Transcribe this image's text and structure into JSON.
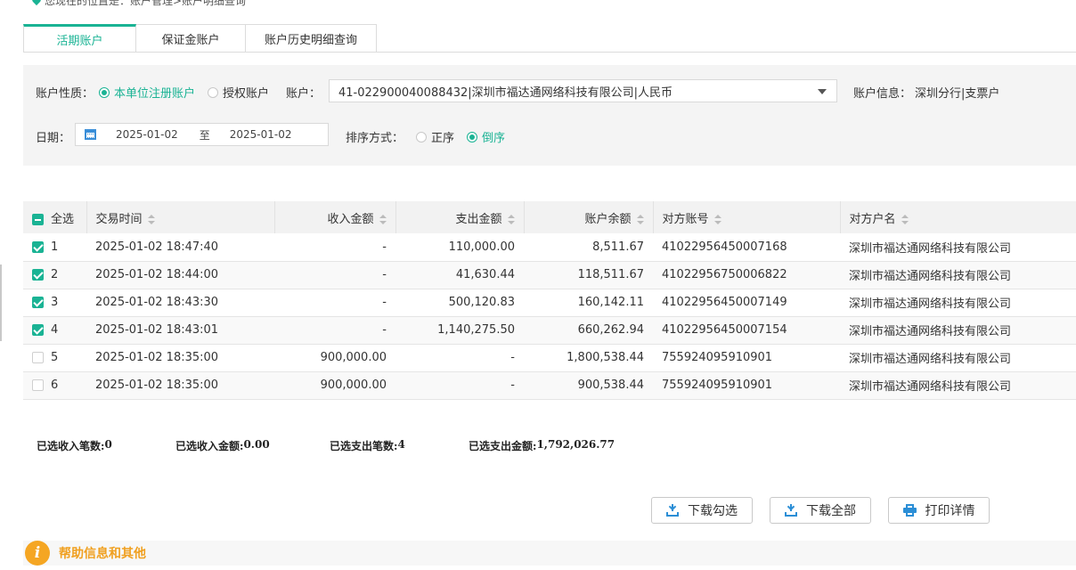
{
  "breadcrumb": "您现在的位置是：账户管理>账户明细查询",
  "tabs": [
    "活期账户",
    "保证金账户",
    "账户历史明细查询"
  ],
  "filters": {
    "account_type_label": "账户性质：",
    "account_type_options": [
      "本单位注册账户",
      "授权账户"
    ],
    "account_type_selected": "本单位注册账户",
    "account_label": "账户：",
    "account_value": "41-022900040088432|深圳市福达通网络科技有限公司|人民币",
    "account_info_label": "账户信息：",
    "account_info_value": "深圳分行|支票户",
    "date_label": "日期：",
    "date_from": "2025-01-02",
    "date_sep": "至",
    "date_to": "2025-01-02",
    "sort_label": "排序方式：",
    "sort_options": [
      "正序",
      "倒序"
    ],
    "sort_selected": "倒序"
  },
  "table": {
    "select_all_label": "全选",
    "columns": [
      "交易时间",
      "收入金额",
      "支出金额",
      "账户余额",
      "对方账号",
      "对方户名"
    ],
    "rows": [
      {
        "no": "1",
        "checked": true,
        "time": "2025-01-02 18:47:40",
        "income": "-",
        "expense": "110,000.00",
        "balance": "8,511.67",
        "account": "41022956450007168",
        "name": "深圳市福达通网络科技有限公司"
      },
      {
        "no": "2",
        "checked": true,
        "time": "2025-01-02 18:44:00",
        "income": "-",
        "expense": "41,630.44",
        "balance": "118,511.67",
        "account": "41022956750006822",
        "name": "深圳市福达通网络科技有限公司"
      },
      {
        "no": "3",
        "checked": true,
        "time": "2025-01-02 18:43:30",
        "income": "-",
        "expense": "500,120.83",
        "balance": "160,142.11",
        "account": "41022956450007149",
        "name": "深圳市福达通网络科技有限公司"
      },
      {
        "no": "4",
        "checked": true,
        "time": "2025-01-02 18:43:01",
        "income": "-",
        "expense": "1,140,275.50",
        "balance": "660,262.94",
        "account": "41022956450007154",
        "name": "深圳市福达通网络科技有限公司"
      },
      {
        "no": "5",
        "checked": false,
        "time": "2025-01-02 18:35:00",
        "income": "900,000.00",
        "expense": "-",
        "balance": "1,800,538.44",
        "account": "755924095910901",
        "name": "深圳市福达通网络科技有限公司"
      },
      {
        "no": "6",
        "checked": false,
        "time": "2025-01-02 18:35:00",
        "income": "900,000.00",
        "expense": "-",
        "balance": "900,538.44",
        "account": "755924095910901",
        "name": "深圳市福达通网络科技有限公司"
      }
    ]
  },
  "summary": [
    {
      "label": "已选收入笔数: ",
      "value": "0"
    },
    {
      "label": "已选收入金额: ",
      "value": "0.00"
    },
    {
      "label": "已选支出笔数: ",
      "value": "4"
    },
    {
      "label": "已选支出金额: ",
      "value": "1,792,026.77"
    }
  ],
  "buttons": {
    "download_selected": "下载勾选",
    "download_all": "下载全部",
    "print_detail": "打印详情"
  },
  "help": {
    "icon_text": "i",
    "title": "帮助信息和其他"
  },
  "colors": {
    "accent": "#1ab394",
    "icon_blue": "#2b8ed6",
    "help_orange": "#f5a623"
  }
}
